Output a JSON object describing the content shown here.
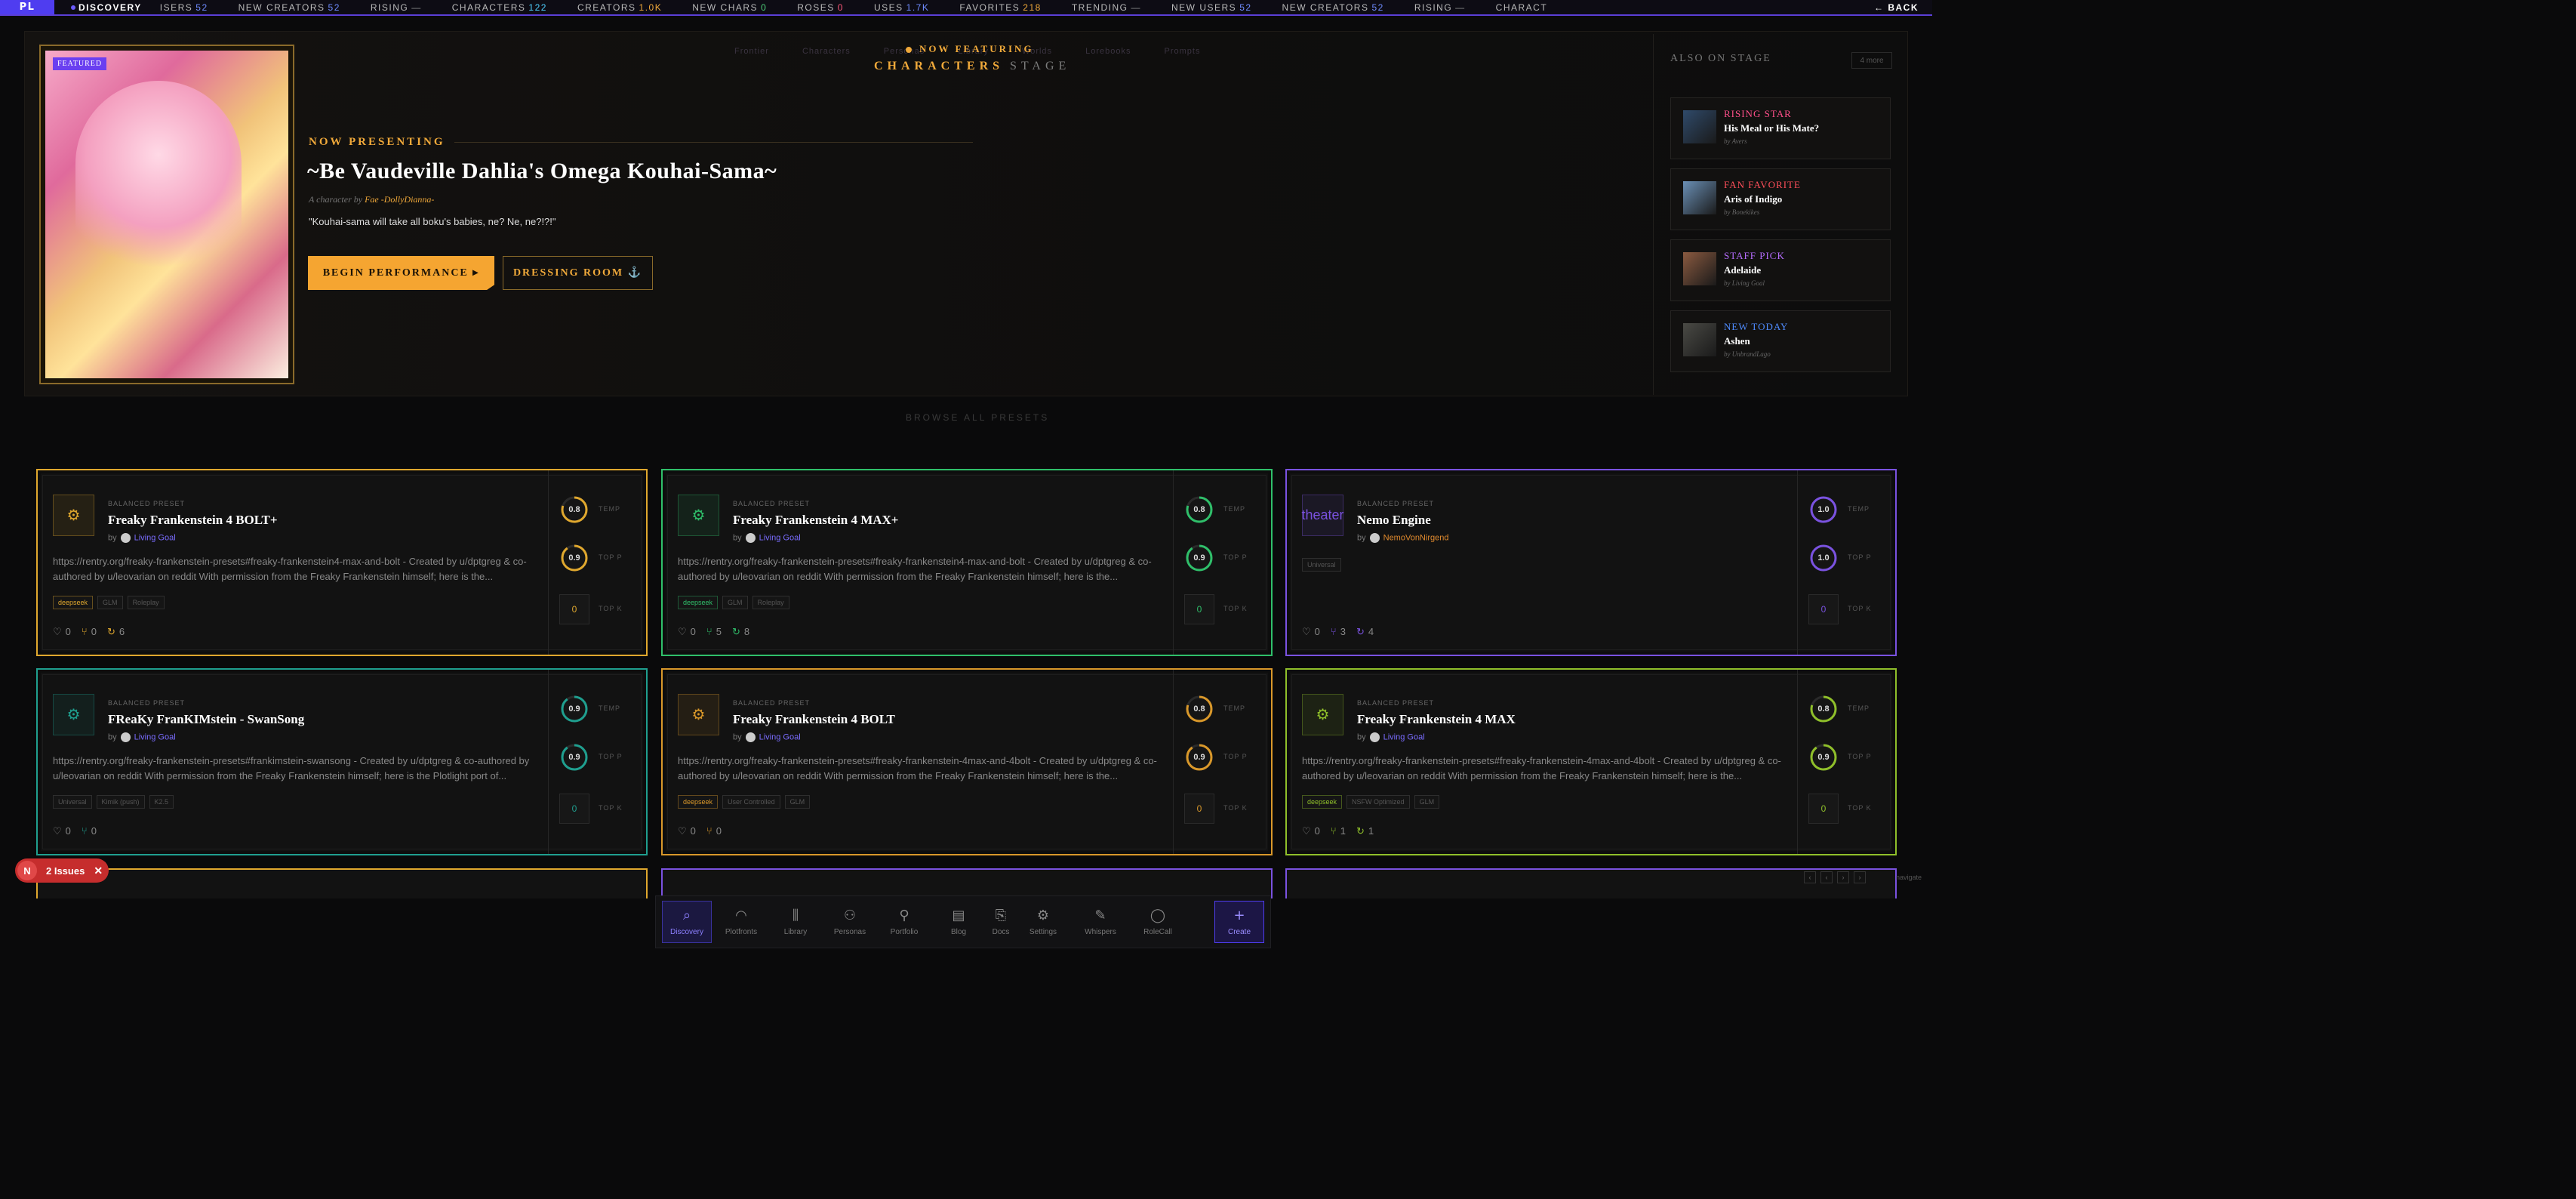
{
  "ticker": {
    "logo": "PL",
    "label": "DISCOVERY",
    "items": [
      {
        "k": "ISERS",
        "v": "52",
        "c": "#6f8cff"
      },
      {
        "k": "NEW CREATORS",
        "v": "52",
        "c": "#6f8cff"
      },
      {
        "k": "RISING",
        "v": "—",
        "c": "#888"
      },
      {
        "k": "CHARACTERS",
        "v": "122",
        "c": "#4fd0ff"
      },
      {
        "k": "CREATORS",
        "v": "1.0K",
        "c": "#f0a93a"
      },
      {
        "k": "NEW CHARS",
        "v": "0",
        "c": "#4fd07a"
      },
      {
        "k": "ROSES",
        "v": "0",
        "c": "#ff5a7a"
      },
      {
        "k": "USES",
        "v": "1.7K",
        "c": "#6f8cff"
      },
      {
        "k": "FAVORITES",
        "v": "218",
        "c": "#f0a93a"
      },
      {
        "k": "TRENDING",
        "v": "—",
        "c": "#888"
      },
      {
        "k": "NEW USERS",
        "v": "52",
        "c": "#6f8cff"
      },
      {
        "k": "NEW CREATORS",
        "v": "52",
        "c": "#6f8cff"
      },
      {
        "k": "RISING",
        "v": "—",
        "c": "#888"
      },
      {
        "k": "CHARACT",
        "v": "",
        "c": "#888"
      }
    ],
    "back": "← BACK"
  },
  "hero": {
    "ghost": "Frontier Characters Personas Library Worlds Lorebooks Prompts",
    "badge": "FEATURED",
    "now_featuring": "NOW FEATURING",
    "stage_c": "CHARACTERS",
    "stage_s": "STAGE",
    "presenting": "NOW PRESENTING",
    "title": "~Be Vaudeville Dahlia's Omega Kouhai-Sama~",
    "by_prefix": "A character by",
    "author": "Fae -DollyDianna-",
    "quote": "\"Kouhai-sama will take all boku's babies, ne? Ne, ne?!?!\"",
    "begin": "BEGIN PERFORMANCE ▸",
    "dress": "DRESSING ROOM ⚓"
  },
  "side": {
    "title": "ALSO ON STAGE",
    "more": "4 more",
    "cards": [
      {
        "kind": "RISING STAR",
        "color": "#ff4f8a",
        "name": "His Meal or His Mate?",
        "by": "by Avers",
        "thumb": "#2f4a6a"
      },
      {
        "kind": "FAN FAVORITE",
        "color": "#ff4f5a",
        "name": "Aris of Indigo",
        "by": "by Bonekikes",
        "thumb": "#6a8fb5"
      },
      {
        "kind": "STAFF PICK",
        "color": "#b66dff",
        "name": "Adelaide",
        "by": "by Living Goal",
        "thumb": "#8a5a40"
      },
      {
        "kind": "NEW TODAY",
        "color": "#4f8cff",
        "name": "Ashen",
        "by": "by UnbrandLago",
        "thumb": "#4a4a45"
      }
    ]
  },
  "browse": "BROWSE ALL PRESETS",
  "presets": [
    {
      "color": "#e0a82e",
      "icon": "⚙",
      "kind": "BALANCED PRESET",
      "title": "Freaky Frankenstein 4 BOLT+",
      "author": "Living Goal",
      "author_c": "#7a6cff",
      "desc": "https://rentry.org/freaky-frankenstein-presets#freaky-frankenstein4-max-and-bolt - Created by u/dptgreg & co-authored by u/leovarian on reddit With permission from the Freaky Frankenstein himself; here is the...",
      "tags": [
        "deepseek",
        "GLM",
        "Roleplay"
      ],
      "likes": "0",
      "forks": "0",
      "uses": "6",
      "temp": "0.8",
      "topp": "0.9",
      "topk": "0",
      "tempv": 0.8,
      "toppv": 0.9
    },
    {
      "color": "#2fbf6a",
      "icon": "⚙",
      "kind": "BALANCED PRESET",
      "title": "Freaky Frankenstein 4 MAX+",
      "author": "Living Goal",
      "author_c": "#7a6cff",
      "desc": "https://rentry.org/freaky-frankenstein-presets#freaky-frankenstein4-max-and-bolt - Created by u/dptgreg & co-authored by u/leovarian on reddit With permission from the Freaky Frankenstein himself; here is the...",
      "tags": [
        "deepseek",
        "GLM",
        "Roleplay"
      ],
      "likes": "0",
      "forks": "5",
      "uses": "8",
      "temp": "0.8",
      "topp": "0.9",
      "topk": "0",
      "tempv": 0.8,
      "toppv": 0.9
    },
    {
      "color": "#7a52e0",
      "icon": "theater",
      "kind": "BALANCED PRESET",
      "title": "Nemo Engine",
      "author": "NemoVonNirgend",
      "author_c": "#e08a2e",
      "desc": "",
      "tags": [
        "Universal"
      ],
      "likes": "0",
      "forks": "3",
      "uses": "4",
      "temp": "1.0",
      "topp": "1.0",
      "topk": "0",
      "tempv": 1.0,
      "toppv": 1.0
    },
    {
      "color": "#1f9f8f",
      "icon": "⚙",
      "kind": "BALANCED PRESET",
      "title": "FReaKy FranKIMstein - SwanSong",
      "author": "Living Goal",
      "author_c": "#7a6cff",
      "desc": "https://rentry.org/freaky-frankenstein-presets#frankimstein-swansong - Created by u/dptgreg & co-authored by u/leovarian on reddit With permission from the Freaky Frankenstein himself; here is the Plotlight port of...",
      "tags": [
        "Universal",
        "Kimik (push)",
        "K2.5"
      ],
      "likes": "0",
      "forks": "0",
      "uses": "",
      "temp": "0.9",
      "topp": "0.9",
      "topk": "0",
      "tempv": 0.9,
      "toppv": 0.9
    },
    {
      "color": "#d9982a",
      "icon": "⚙",
      "kind": "BALANCED PRESET",
      "title": "Freaky Frankenstein 4 BOLT",
      "author": "Living Goal",
      "author_c": "#7a6cff",
      "desc": "https://rentry.org/freaky-frankenstein-presets#freaky-frankenstein-4max-and-4bolt - Created by u/dptgreg & co-authored by u/leovarian on reddit With permission from the Freaky Frankenstein himself; here is the...",
      "tags": [
        "deepseek",
        "User Controlled",
        "GLM"
      ],
      "likes": "0",
      "forks": "0",
      "uses": "",
      "temp": "0.8",
      "topp": "0.9",
      "topk": "0",
      "tempv": 0.8,
      "toppv": 0.9
    },
    {
      "color": "#8fbf2a",
      "icon": "⚙",
      "kind": "BALANCED PRESET",
      "title": "Freaky Frankenstein 4 MAX",
      "author": "Living Goal",
      "author_c": "#7a6cff",
      "desc": "https://rentry.org/freaky-frankenstein-presets#freaky-frankenstein-4max-and-4bolt - Created by u/dptgreg & co-authored by u/leovarian on reddit With permission from the Freaky Frankenstein himself; here is the...",
      "tags": [
        "deepseek",
        "NSFW Optimized",
        "GLM"
      ],
      "likes": "0",
      "forks": "1",
      "uses": "1",
      "temp": "0.8",
      "topp": "0.9",
      "topk": "0",
      "tempv": 0.8,
      "toppv": 0.9
    }
  ],
  "gauge_labels": {
    "temp": "TEMP",
    "topp": "TOP P",
    "topk": "TOP K"
  },
  "issues": {
    "n": "N",
    "text": "2 Issues",
    "x": "✕"
  },
  "dock": [
    {
      "g": "⌕",
      "label": "Discovery",
      "active": true
    },
    {
      "g": "◠",
      "label": "Plotfronts"
    },
    {
      "g": "⫼",
      "label": "Library"
    },
    {
      "g": "⚇",
      "label": "Personas"
    },
    {
      "g": "⚲",
      "label": "Portfolio"
    },
    {
      "g": "▤",
      "label": "Blog"
    },
    {
      "g": "⎘",
      "label": "Docs"
    },
    {
      "g": "⚙",
      "label": "Settings"
    },
    {
      "g": "✎",
      "label": "Whispers"
    },
    {
      "g": "◯",
      "label": "RoleCall"
    },
    {
      "g": "+",
      "label": "Create",
      "create": true
    }
  ],
  "pager": [
    "‹",
    "‹",
    "›",
    "›"
  ],
  "nav_hint": "navigate"
}
